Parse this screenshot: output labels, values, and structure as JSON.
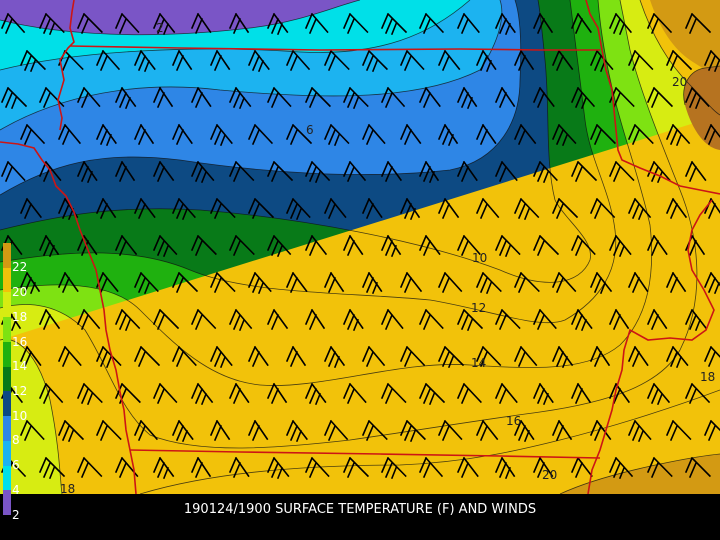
{
  "caption": "190124/1900 SURFACE TEMPERATURE (F) AND WINDS",
  "colors": {
    "band_02": "#7a55c6",
    "band_04": "#00e0e8",
    "band_06": "#1cb3f0",
    "band_08": "#2e86e6",
    "band_10": "#0d4a83",
    "band_12": "#087a18",
    "band_14": "#1fb10f",
    "band_16": "#7ee212",
    "band_18": "#d7ec12",
    "band_20": "#f2c20a",
    "band_22": "#d39a13",
    "band_24": "#b67320",
    "borders": "#cc1515",
    "barbs": "#000000"
  },
  "colorbar": {
    "entries": [
      {
        "label": "22",
        "color": "#d39a13"
      },
      {
        "label": "20",
        "color": "#f2c20a"
      },
      {
        "label": "18",
        "color": "#d7ec12"
      },
      {
        "label": "16",
        "color": "#7ee212"
      },
      {
        "label": "14",
        "color": "#1fb10f"
      },
      {
        "label": "12",
        "color": "#087a18"
      },
      {
        "label": "10",
        "color": "#0d4a83"
      },
      {
        "label": "8",
        "color": "#2e86e6"
      },
      {
        "label": "6",
        "color": "#1cb3f0"
      },
      {
        "label": "4",
        "color": "#00e0e8"
      },
      {
        "label": "2",
        "color": "#7a55c6"
      }
    ]
  },
  "contour_labels": {
    "c2": "2",
    "c6": "6",
    "c10": "10",
    "c12": "12",
    "c14": "14",
    "c16": "16",
    "c18_left": "18",
    "c18_right": "18",
    "c20_top": "20",
    "c20_bottom": "20"
  },
  "wind_barb_icon": "wind-barb-icon"
}
